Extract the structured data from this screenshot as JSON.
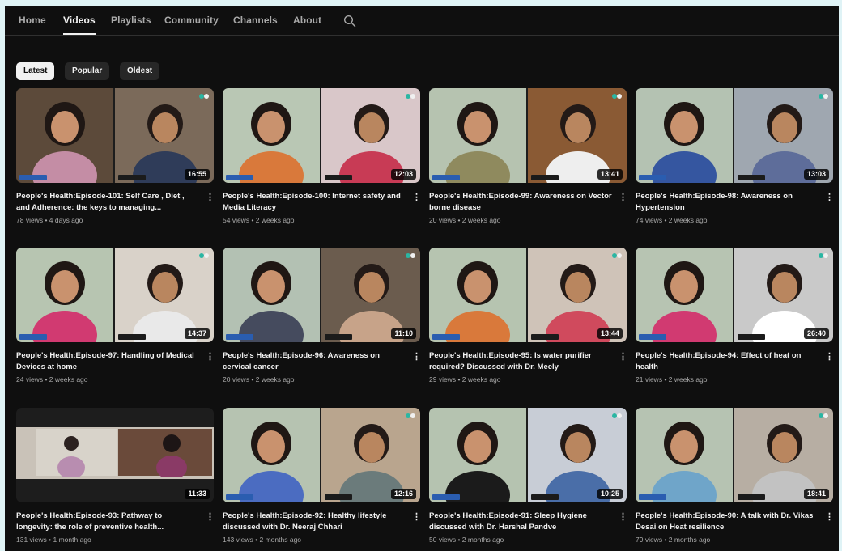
{
  "nav": {
    "tabs": [
      {
        "label": "Home"
      },
      {
        "label": "Videos"
      },
      {
        "label": "Playlists"
      },
      {
        "label": "Community"
      },
      {
        "label": "Channels"
      },
      {
        "label": "About"
      }
    ],
    "active_tab": "Videos",
    "search_icon": "search-icon"
  },
  "filters": {
    "chips": [
      {
        "label": "Latest"
      },
      {
        "label": "Popular"
      },
      {
        "label": "Oldest"
      }
    ],
    "selected": "Latest"
  },
  "videos": [
    {
      "title": "People's Health:Episode-101: Self Care , Diet , and Adherence: the keys to managing...",
      "views": "78 views",
      "age": "4 days ago",
      "duration": "16:55"
    },
    {
      "title": "People's Health:Episode-100: Internet safety and Media Literacy",
      "views": "54 views",
      "age": "2 weeks ago",
      "duration": "12:03"
    },
    {
      "title": "People's Health:Episode-99: Awareness on Vector borne disease",
      "views": "20 views",
      "age": "2 weeks ago",
      "duration": "13:41"
    },
    {
      "title": "People's Health:Episode-98: Awareness on Hypertension",
      "views": "74 views",
      "age": "2 weeks ago",
      "duration": "13:03"
    },
    {
      "title": "People's Health:Episode-97: Handling of Medical Devices at home",
      "views": "24 views",
      "age": "2 weeks ago",
      "duration": "14:37"
    },
    {
      "title": "People's Health:Episode-96: Awareness on cervical cancer",
      "views": "20 views",
      "age": "2 weeks ago",
      "duration": "11:10"
    },
    {
      "title": "People's Health:Episode-95: Is water purifier required? Discussed with Dr. Meely",
      "views": "29 views",
      "age": "2 weeks ago",
      "duration": "13:44"
    },
    {
      "title": "People's Health:Episode-94: Effect of heat on health",
      "views": "21 views",
      "age": "2 weeks ago",
      "duration": "26:40"
    },
    {
      "title": "People's Health:Episode-93: Pathway to longevity: the role of preventive health...",
      "views": "131 views",
      "age": "1 month ago",
      "duration": "11:33"
    },
    {
      "title": "People's Health:Episode-92: Healthy lifestyle discussed with Dr. Neeraj Chhari",
      "views": "143 views",
      "age": "2 months ago",
      "duration": "12:16"
    },
    {
      "title": "People's Health:Episode-91: Sleep Hygiene discussed with Dr. Harshal Pandve",
      "views": "50 views",
      "age": "2 months ago",
      "duration": "10:25"
    },
    {
      "title": "People's Health:Episode-90: A talk with Dr. Vikas Desai on Heat resilience",
      "views": "79 views",
      "age": "2 months ago",
      "duration": "18:41"
    }
  ],
  "colors": {
    "background": "#0f0f0f",
    "text": "#f1f1f1",
    "secondary_text": "#aaaaaa",
    "chip": "#272727"
  }
}
